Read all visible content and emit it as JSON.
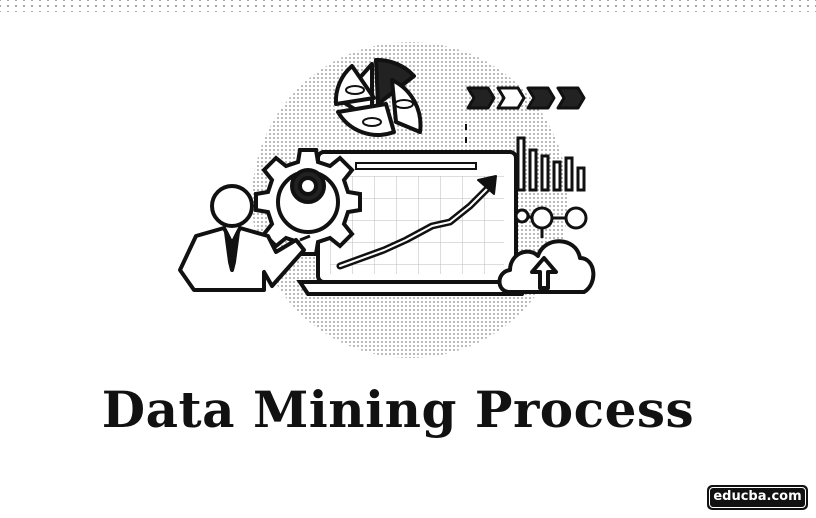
{
  "title": "Data Mining Process",
  "brand": "educba.com",
  "colors": {
    "ink": "#111111",
    "background": "#ffffff",
    "dot_pattern": "#9a9a9a"
  },
  "illustration": {
    "icons": [
      "pie-chart-icon",
      "arrow-chevrons-icon",
      "bar-chart-icon",
      "gear-icon",
      "laptop-icon",
      "rising-line-chart-icon",
      "businessman-icon",
      "cloud-upload-icon",
      "network-nodes-icon"
    ]
  }
}
